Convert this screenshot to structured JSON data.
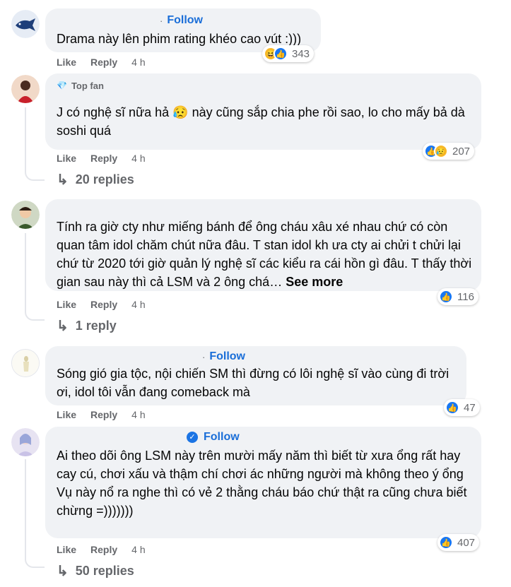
{
  "comments": [
    {
      "follow_label": "Follow",
      "text": "Drama này lên phim rating khéo cao vút :)))",
      "like": "Like",
      "reply": "Reply",
      "time": "4 h",
      "reaction_icons": [
        "haha-icon",
        "like-icon"
      ],
      "reaction_count": "343"
    },
    {
      "badge": "Top fan",
      "text": "J có nghệ sĩ nữa hả 😥 này cũng sắp chia phe rồi sao, lo cho mấy bả dà soshi quá",
      "like": "Like",
      "reply": "Reply",
      "time": "4 h",
      "reaction_icons": [
        "like-icon",
        "sad-icon"
      ],
      "reaction_count": "207",
      "replies": "20 replies"
    },
    {
      "text": "Tính ra giờ cty như miếng bánh để ông cháu xâu xé nhau chứ có còn quan tâm idol chăm chút nữa đâu. T stan idol kh ưa cty ai chửi t chửi lại chứ từ 2020 tới giờ quản lý nghệ sĩ các kiểu ra cái hồn gì đâu. T thấy thời gian sau này thì cả LSM và 2 ông chá… ",
      "see_more": "See more",
      "like": "Like",
      "reply": "Reply",
      "time": "4 h",
      "reaction_icons": [
        "like-icon"
      ],
      "reaction_count": "116",
      "replies": "1 reply"
    },
    {
      "follow_label": "Follow",
      "text": "Sóng gió gia tộc, nội chiến SM thì đừng có lôi nghệ sĩ vào cùng đi trời ơi, idol tôi vẫn đang comeback mà",
      "like": "Like",
      "reply": "Reply",
      "time": "4 h",
      "reaction_icons": [
        "like-icon"
      ],
      "reaction_count": "47"
    },
    {
      "follow_label": "Follow",
      "text_lines": [
        "Ai theo dõi ông LSM này trên mười mấy năm thì biết từ xưa ổng rất hay cay cú, chơi xấu và thậm chí chơi ác những người mà không theo ý ổng",
        "Vụ này nổ ra nghe thì có vẻ 2 thằng cháu báo chứ thật ra cũng chưa biết chừng =)))))))"
      ],
      "like": "Like",
      "reply": "Reply",
      "time": "4 h",
      "reaction_icons": [
        "like-icon"
      ],
      "reaction_count": "407",
      "replies": "50 replies"
    }
  ],
  "icons": {
    "like": "👍",
    "haha": "😆",
    "sad": "😥",
    "reply_arrow": "↳",
    "gem": "💎",
    "verified": "✓"
  }
}
